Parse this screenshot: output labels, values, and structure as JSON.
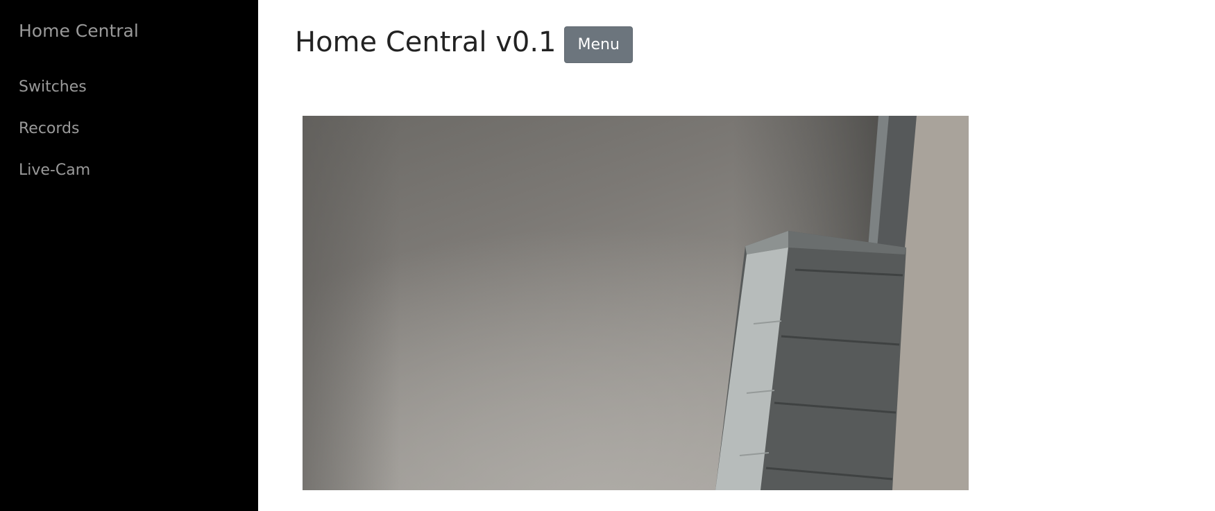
{
  "sidebar": {
    "brand": "Home Central",
    "items": [
      {
        "label": "Switches"
      },
      {
        "label": "Records"
      },
      {
        "label": "Live-Cam"
      }
    ]
  },
  "main": {
    "title": "Home Central v0.1",
    "menu_button": "Menu"
  },
  "colors": {
    "sidebar_bg": "#000000",
    "sidebar_text": "#9a9a9a",
    "button_bg": "#6c757d"
  }
}
